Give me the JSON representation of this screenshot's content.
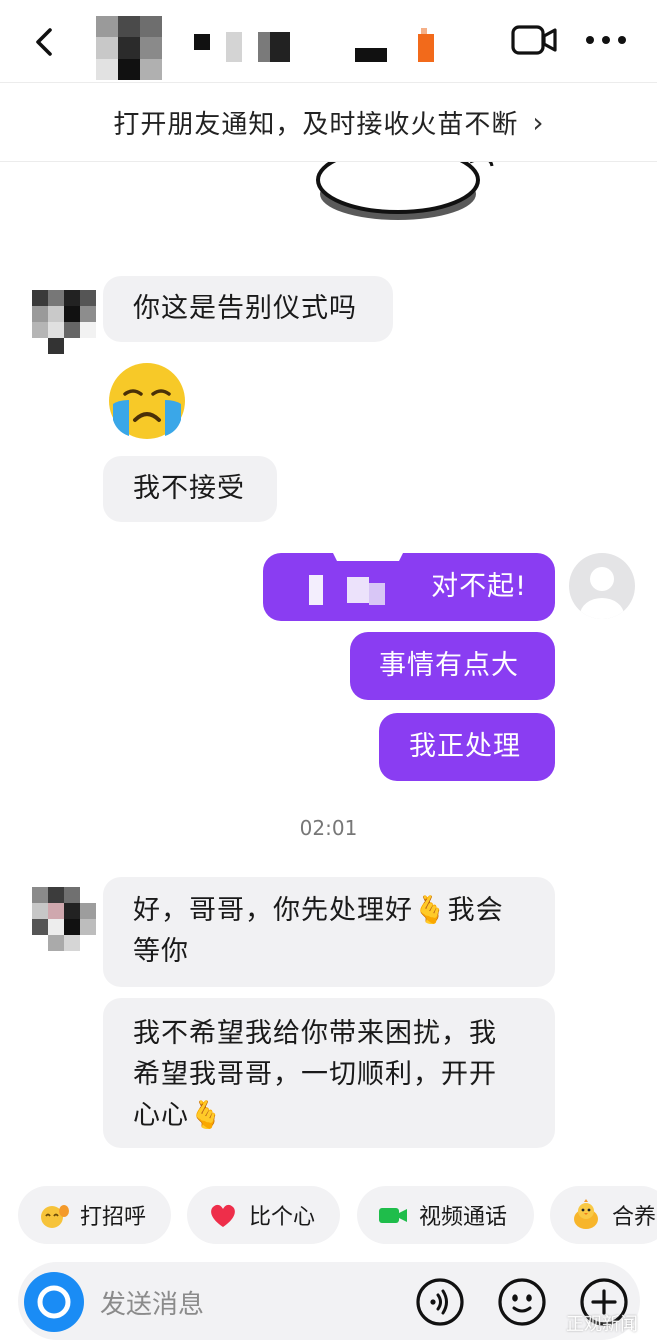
{
  "header": {
    "back_icon": "chevron-left-icon",
    "video_icon": "video-camera-icon",
    "more_icon": "more-dots-icon"
  },
  "notification": {
    "text": "打开朋友通知，及时接收火苗不断",
    "chevron": "›"
  },
  "messages": [
    {
      "side": "in",
      "text": "你这是告别仪式吗"
    },
    {
      "side": "in",
      "type": "emoji",
      "emoji": "crying-face-icon"
    },
    {
      "side": "in",
      "text": "我不接受"
    },
    {
      "side": "out",
      "text": "对不起!"
    },
    {
      "side": "out",
      "text": "事情有点大"
    },
    {
      "side": "out",
      "text": "我正处理"
    },
    {
      "type": "time",
      "text": "02:01"
    },
    {
      "side": "in",
      "lines": [
        "好，哥哥，你先处理好🫰我会",
        "等你"
      ]
    },
    {
      "side": "in",
      "lines": [
        "我不希望我给你带来困扰，我",
        "希望我哥哥，一切顺利，开开",
        "心心🫰"
      ]
    }
  ],
  "quick_actions": [
    {
      "label": "打招呼",
      "icon": "wave-hand-icon"
    },
    {
      "label": "比个心",
      "icon": "heart-icon"
    },
    {
      "label": "视频通话",
      "icon": "video-call-icon"
    },
    {
      "label": "合养",
      "icon": "chick-icon"
    }
  ],
  "input": {
    "placeholder": "发送消息",
    "camera_icon": "camera-icon",
    "voice_icon": "voice-icon",
    "emoji_icon": "emoji-icon",
    "plus_icon": "plus-icon"
  },
  "watermark": "正观新闻",
  "colors": {
    "outgoing_bubble": "#8a3df2",
    "incoming_bubble": "#f1f1f3",
    "camera_button": "#1a8cf5",
    "name_accent": "#f26a1b"
  }
}
